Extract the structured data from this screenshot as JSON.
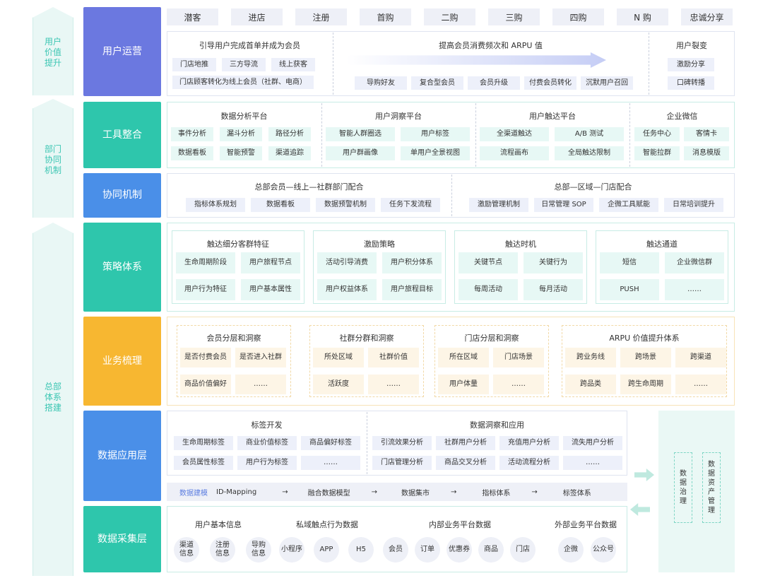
{
  "left_col": [
    "用户\n价值\n提升",
    "部门\n协同\n机制",
    "总部\n体系\n搭建"
  ],
  "layers": {
    "user_ops": "用户运营",
    "tools": "工具整合",
    "collab": "协同机制",
    "strategy": "策略体系",
    "business": "业务梳理",
    "data_app": "数据应用层",
    "data_collect": "数据采集层"
  },
  "stages": [
    "潜客",
    "进店",
    "注册",
    "首购",
    "二购",
    "三购",
    "四购",
    "N 购",
    "忠诚分享"
  ],
  "user_ops": {
    "g1_title": "引导用户完成首单并成为会员",
    "g1_items": [
      "门店地推",
      "三方导流",
      "线上获客"
    ],
    "g1_wide": "门店顾客转化为线上会员（社群、电商）",
    "g2_title": "提高会员消费频次和 ARPU 值",
    "g2_items": [
      "导购好友",
      "复合型会员",
      "会员升级",
      "付费会员转化",
      "沉默用户召回"
    ],
    "g3_title": "用户裂变",
    "g3_items": [
      "激励分享",
      "口碑转播"
    ]
  },
  "tools": [
    {
      "title": "数据分析平台",
      "items": [
        "事件分析",
        "漏斗分析",
        "路径分析",
        "数据看板",
        "智能预警",
        "渠道追踪"
      ]
    },
    {
      "title": "用户洞察平台",
      "items": [
        "智能人群圈选",
        "用户标签",
        "用户群画像",
        "单用户全景视图"
      ]
    },
    {
      "title": "用户触达平台",
      "items": [
        "全渠道触达",
        "A/B 测试",
        "流程画布",
        "全局触达限制"
      ]
    },
    {
      "title": "企业微信",
      "items": [
        "任务中心",
        "客情卡",
        "智能拉群",
        "消息模版"
      ]
    }
  ],
  "collab": {
    "t1": "总部会员—线上—社群部门配合",
    "i1": [
      "指标体系规划",
      "数据看板",
      "数据预警机制",
      "任务下发流程"
    ],
    "t2": "总部—区域—门店配合",
    "i2": [
      "激励管理机制",
      "日常管理 SOP",
      "企微工具赋能",
      "日常培训提升"
    ]
  },
  "strategy": [
    {
      "title": "触达细分客群特征",
      "items": [
        "生命周期阶段",
        "用户旅程节点",
        "用户行为特征",
        "用户基本属性"
      ]
    },
    {
      "title": "激励策略",
      "items": [
        "活动引导消费",
        "用户积分体系",
        "用户权益体系",
        "用户旅程目标"
      ]
    },
    {
      "title": "触达时机",
      "items": [
        "关键节点",
        "关键行为",
        "每周活动",
        "每月活动"
      ]
    },
    {
      "title": "触达通道",
      "items": [
        "短信",
        "企业微信群",
        "PUSH",
        "……"
      ]
    }
  ],
  "business": [
    {
      "title": "会员分层和洞察",
      "items": [
        "是否付费会员",
        "是否进入社群",
        "商品价值偏好",
        "……"
      ]
    },
    {
      "title": "社群分群和洞察",
      "items": [
        "所处区域",
        "社群价值",
        "活跃度",
        "……"
      ]
    },
    {
      "title": "门店分层和洞察",
      "items": [
        "所在区域",
        "门店场景",
        "用户体量",
        "……"
      ]
    },
    {
      "title": "ARPU 价值提升体系",
      "items": [
        "跨业务线",
        "跨场景",
        "跨渠道",
        "跨品类",
        "跨生命周期",
        "……"
      ]
    }
  ],
  "data_app": {
    "t1": "标签开发",
    "i1": [
      "生命周期标签",
      "商业价值标签",
      "商品偏好标签",
      "会员属性标签",
      "用户行为标签",
      "……"
    ],
    "t2": "数据洞察和应用",
    "i2": [
      "引流效果分析",
      "社群用户分析",
      "充值用户分析",
      "流失用户分析",
      "门店管理分析",
      "商品交叉分析",
      "活动流程分析",
      "……"
    ],
    "flow": [
      "数据建模",
      "ID-Mapping",
      "融合数据模型",
      "数据集市",
      "指标体系",
      "标签体系"
    ],
    "arrow": "→"
  },
  "data_collect": [
    {
      "title": "用户基本信息",
      "items": [
        "渠道\n信息",
        "注册\n信息",
        "导购\n信息"
      ]
    },
    {
      "title": "私域触点行为数据",
      "items": [
        "小程序",
        "APP",
        "H5"
      ]
    },
    {
      "title": "内部业务平台数据",
      "items": [
        "会员",
        "订单",
        "优惠券",
        "商品",
        "门店"
      ]
    },
    {
      "title": "外部业务平台数据",
      "items": [
        "企微",
        "公众号"
      ]
    }
  ],
  "right": {
    "a": "数\n据\n治\n理",
    "b": "数\n据\n资\n产\n管\n理"
  },
  "colors": {
    "purple": "#6b78e0",
    "teal": "#2ec6ac",
    "blue": "#4a8fe8",
    "orange": "#f7b731"
  }
}
